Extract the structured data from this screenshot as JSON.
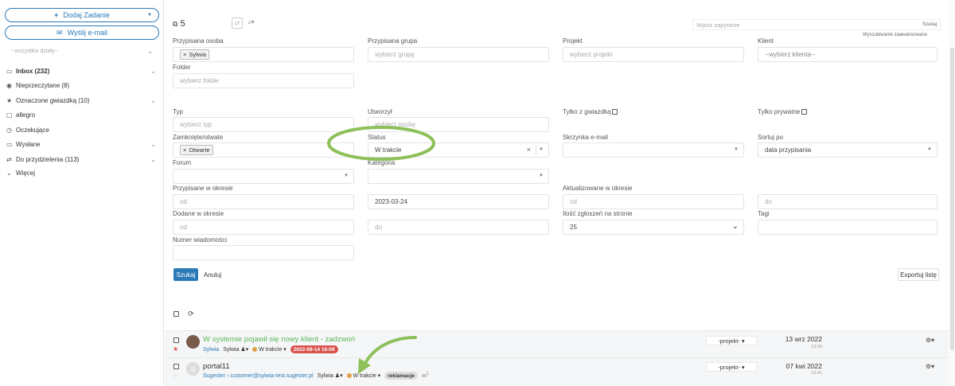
{
  "sidebar": {
    "add_task": "Dodaj Zadanie",
    "send_email": "Wyślij e-mail",
    "departments": "--wszystkie działy--",
    "items": [
      {
        "label": "Inbox (232)",
        "icon": "inbox-icon"
      },
      {
        "label": "Nieprzeczytane (8)",
        "icon": "eye-icon"
      },
      {
        "label": "Oznaczone gwiazdką (10)",
        "icon": "star-icon"
      },
      {
        "label": "allegro",
        "icon": "folder-icon"
      },
      {
        "label": "Oczekujące",
        "icon": "clock-icon"
      },
      {
        "label": "Wysłane",
        "icon": "inbox-icon"
      },
      {
        "label": "Do przydzielenia (113)",
        "icon": "transfer-icon"
      },
      {
        "label": "Więcej",
        "icon": "chevron-down-icon"
      }
    ]
  },
  "topbar": {
    "count": "5",
    "search_placeholder": "Wpisz zapytanie",
    "search_btn": "Szukaj",
    "advanced": "Wyszukiwanie zaawansowane"
  },
  "filters": {
    "assigned_person": {
      "label": "Przypisana osoba",
      "tag": "Sylwia"
    },
    "assigned_group": {
      "label": "Przypisana grupa",
      "placeholder": "wybierz grupę"
    },
    "project": {
      "label": "Projekt",
      "placeholder": "wybierz projekt"
    },
    "client": {
      "label": "Klient",
      "placeholder": "--wybierz klienta--"
    },
    "folder": {
      "label": "Folder",
      "placeholder": "wybierz folder"
    },
    "type": {
      "label": "Typ",
      "placeholder": "wybierz typ"
    },
    "created": {
      "label": "Utworzył",
      "placeholder": "wybierz osobę"
    },
    "starred_only": "Tylko z gwiazdką",
    "private_only": "Tylko prywatne",
    "closed_open": {
      "label": "Zamknięte/otwate",
      "tag": "Otwarte"
    },
    "status": {
      "label": "Status",
      "value": "W trakcie"
    },
    "mailbox": {
      "label": "Skrzynka e-mail"
    },
    "sort_by": {
      "label": "Sortuj po",
      "value": "data przypisania"
    },
    "forum": {
      "label": "Forum"
    },
    "category": {
      "label": "Kategoria"
    },
    "assigned_period": {
      "label": "Przypisane w okresie",
      "from": "od",
      "to": "2023-03-24"
    },
    "updated_period": {
      "label": "Aktualizowane w okresie",
      "from": "od",
      "to": "do"
    },
    "added_period": {
      "label": "Dodane w okresie",
      "from": "od",
      "to": "do"
    },
    "per_page": {
      "label": "Ilość zgłoszeń na stronie",
      "value": "25"
    },
    "tags": {
      "label": "Tagi"
    },
    "message_number": {
      "label": "Numer wiadomości"
    },
    "search": "Szukaj",
    "cancel": "Anuluj",
    "export": "Exportuj listę"
  },
  "tickets": [
    {
      "title": "W systemie pojawił się nowy klient - zadzwoń",
      "client": "Sylwia",
      "assignee": "Sylwia",
      "status": "W trakcie",
      "deadline": "2022-09-14 16:09",
      "project": "-projekt-",
      "date": "13 wrz 2022",
      "time": "13:09"
    },
    {
      "title": "portal11",
      "avatar_letter": "S",
      "client": "Sugester › customer@sylwia-test.sugester.pl",
      "assignee": "Sylwia",
      "status": "W trakcie",
      "tag": "reklamacje",
      "attach_count": "2",
      "project": "-projekt-",
      "date": "07 kwi 2022",
      "time": "13:41"
    }
  ],
  "colors": {
    "primary": "#2a7ab8",
    "annotation": "#8dc05a",
    "badge_red": "#d9534f",
    "status_dot": "#e0a14a"
  }
}
